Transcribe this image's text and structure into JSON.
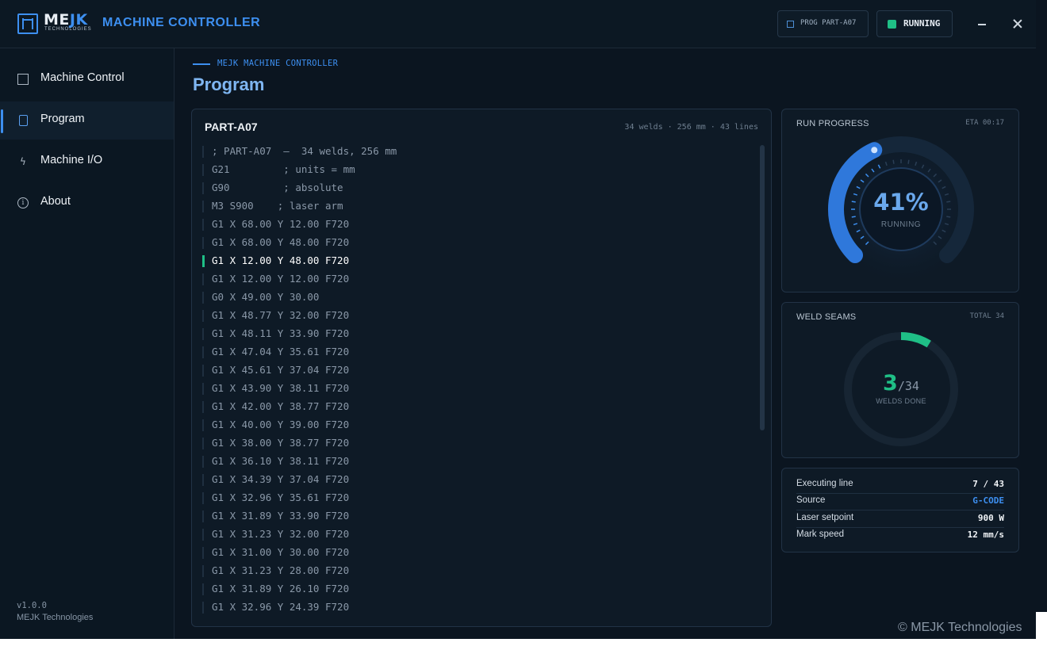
{
  "brand": {
    "name_a": "ME",
    "name_b": "JK",
    "subtitle": "TECHNOLOGIES",
    "app_title": "MACHINE CONTROLLER"
  },
  "status": {
    "program_chip": "PROG PART-A07",
    "run_state": "RUNNING"
  },
  "sidebar": {
    "items": [
      {
        "label": "Machine Control",
        "icon": "chart-icon"
      },
      {
        "label": "Program",
        "icon": "document-icon"
      },
      {
        "label": "Machine I/O",
        "icon": "bolt-icon"
      },
      {
        "label": "About",
        "icon": "info-icon"
      }
    ],
    "version": "v1.0.0",
    "company": "MEJK Technologies"
  },
  "header": {
    "breadcrumb": "MEJK MACHINE CONTROLLER",
    "title": "Program"
  },
  "program": {
    "name": "PART-A07",
    "meta": "34 welds · 256 mm · 43 lines",
    "active_line_index": 6,
    "lines": [
      "; PART-A07  —  34 welds, 256 mm",
      "G21         ; units = mm",
      "G90         ; absolute",
      "M3 S900    ; laser arm",
      "G1 X 68.00 Y 12.00 F720",
      "G1 X 68.00 Y 48.00 F720",
      "G1 X 12.00 Y 48.00 F720",
      "G1 X 12.00 Y 12.00 F720",
      "G0 X 49.00 Y 30.00",
      "G1 X 48.77 Y 32.00 F720",
      "G1 X 48.11 Y 33.90 F720",
      "G1 X 47.04 Y 35.61 F720",
      "G1 X 45.61 Y 37.04 F720",
      "G1 X 43.90 Y 38.11 F720",
      "G1 X 42.00 Y 38.77 F720",
      "G1 X 40.00 Y 39.00 F720",
      "G1 X 38.00 Y 38.77 F720",
      "G1 X 36.10 Y 38.11 F720",
      "G1 X 34.39 Y 37.04 F720",
      "G1 X 32.96 Y 35.61 F720",
      "G1 X 31.89 Y 33.90 F720",
      "G1 X 31.23 Y 32.00 F720",
      "G1 X 31.00 Y 30.00 F720",
      "G1 X 31.23 Y 28.00 F720",
      "G1 X 31.89 Y 26.10 F720",
      "G1 X 32.96 Y 24.39 F720"
    ]
  },
  "run_progress": {
    "label": "RUN PROGRESS",
    "eta": "ETA 00:17",
    "percent": 41,
    "percent_text": "41%",
    "state": "RUNNING"
  },
  "weld_seams": {
    "label": "WELD SEAMS",
    "total_label": "TOTAL 34",
    "done": 3,
    "done_text": "3",
    "total_text": "/34",
    "sub": "WELDS DONE"
  },
  "info": {
    "rows": [
      {
        "key": "Executing line",
        "value": "7 / 43"
      },
      {
        "key": "Source",
        "value": "G-CODE"
      },
      {
        "key": "Laser setpoint",
        "value": "900 W"
      },
      {
        "key": "Mark speed",
        "value": "12 mm/s"
      }
    ]
  },
  "copyright": "© MEJK Technologies",
  "colors": {
    "accent": "#3d8ff0",
    "success": "#1fbf86",
    "background": "#0b1520"
  }
}
